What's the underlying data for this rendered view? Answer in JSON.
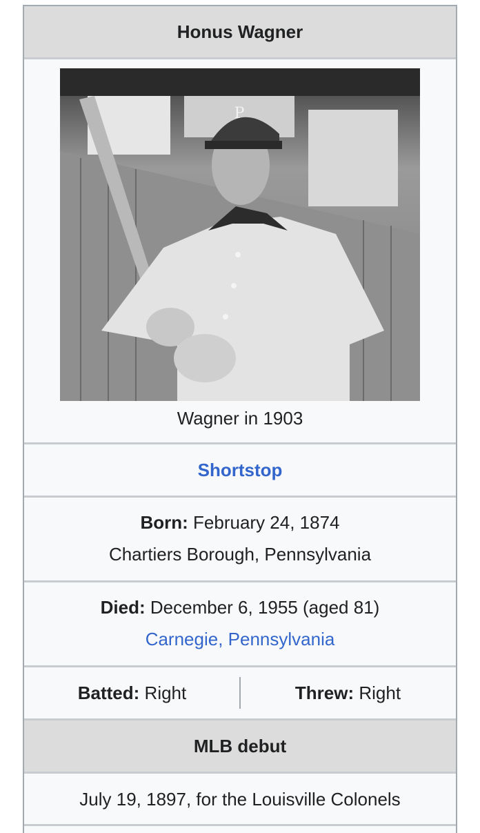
{
  "infobox": {
    "title": "Honus Wagner",
    "image": {
      "alt": "Photo of Honus Wagner holding a bat",
      "caption": "Wagner in 1903"
    },
    "position": "Shortstop",
    "born": {
      "label": "Born:",
      "date": "February 24, 1874",
      "place": "Chartiers Borough, Pennsylvania"
    },
    "died": {
      "label": "Died:",
      "date": "December 6, 1955 (aged 81)",
      "place": "Carnegie, Pennsylvania"
    },
    "batted": {
      "label": "Batted:",
      "value": "Right"
    },
    "threw": {
      "label": "Threw:",
      "value": "Right"
    },
    "debut_header": "MLB debut",
    "debut_value": "July 19, 1897, for the Louisville Colonels"
  },
  "colors": {
    "link": "#3366cc",
    "header_bg": "#dcdcdc",
    "panel_bg": "#f8f9fa",
    "border": "#a2a9b1"
  }
}
